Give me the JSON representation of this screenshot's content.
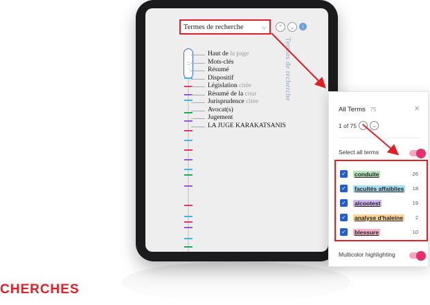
{
  "dropdown": {
    "label": "Termes de recherche",
    "chevron": "⌵"
  },
  "nav": {
    "up": "⌃",
    "down": "⌄",
    "info": "i"
  },
  "vertical_title": "Termes de recherche",
  "outline": {
    "handle_glyph": "::",
    "items": [
      {
        "main": "Haut de",
        "rest": " la page"
      },
      {
        "main": "Mots-clés",
        "rest": ""
      },
      {
        "main": "Résumé",
        "rest": ""
      },
      {
        "main": "Dispositif",
        "rest": ""
      },
      {
        "main": "Législation",
        "rest": " citée"
      },
      {
        "main": "Résumé de la",
        "rest": " cour"
      },
      {
        "main": "Jurisprudence",
        "rest": " citée"
      },
      {
        "main": "Avocat(s)",
        "rest": ""
      },
      {
        "main": "Jugement",
        "rest": ""
      },
      {
        "main": "LA JUGE KARAKATSANIS",
        "rest": ""
      }
    ],
    "highlight_colors": [
      "#41b6e6",
      "#e8306f",
      "#9b51e0",
      "#41b6e6",
      "#1faa59",
      "#9b51e0",
      "#e8306f"
    ]
  },
  "panel": {
    "title": "All Terms",
    "count": "75",
    "close": "×",
    "pager_text": "1 of 75",
    "pager_prev": "⌃",
    "pager_next": "⌄",
    "select_all_label": "Select all terms",
    "select_all_on": true,
    "terms": [
      {
        "label": "conduite",
        "count": "26",
        "color": "#b7e4b9"
      },
      {
        "label": "facultés affaiblies",
        "count": "18",
        "color": "#a6dff2"
      },
      {
        "label": "alcootest",
        "count": "19",
        "color": "#d2b6ef"
      },
      {
        "label": "analyse d'haleine",
        "count": "2",
        "color": "#fbd59a"
      },
      {
        "label": "blessure",
        "count": "10",
        "color": "#f7b3c9"
      }
    ],
    "check_glyph": "✓",
    "multicolor_label": "Multicolor highlighting",
    "multicolor_on": true
  },
  "colors": {
    "accent_red": "#e21f26",
    "toggle_pink": "#e8306f",
    "checkbox_blue": "#1e5fd6"
  },
  "bottom_heading": "CHERCHES"
}
